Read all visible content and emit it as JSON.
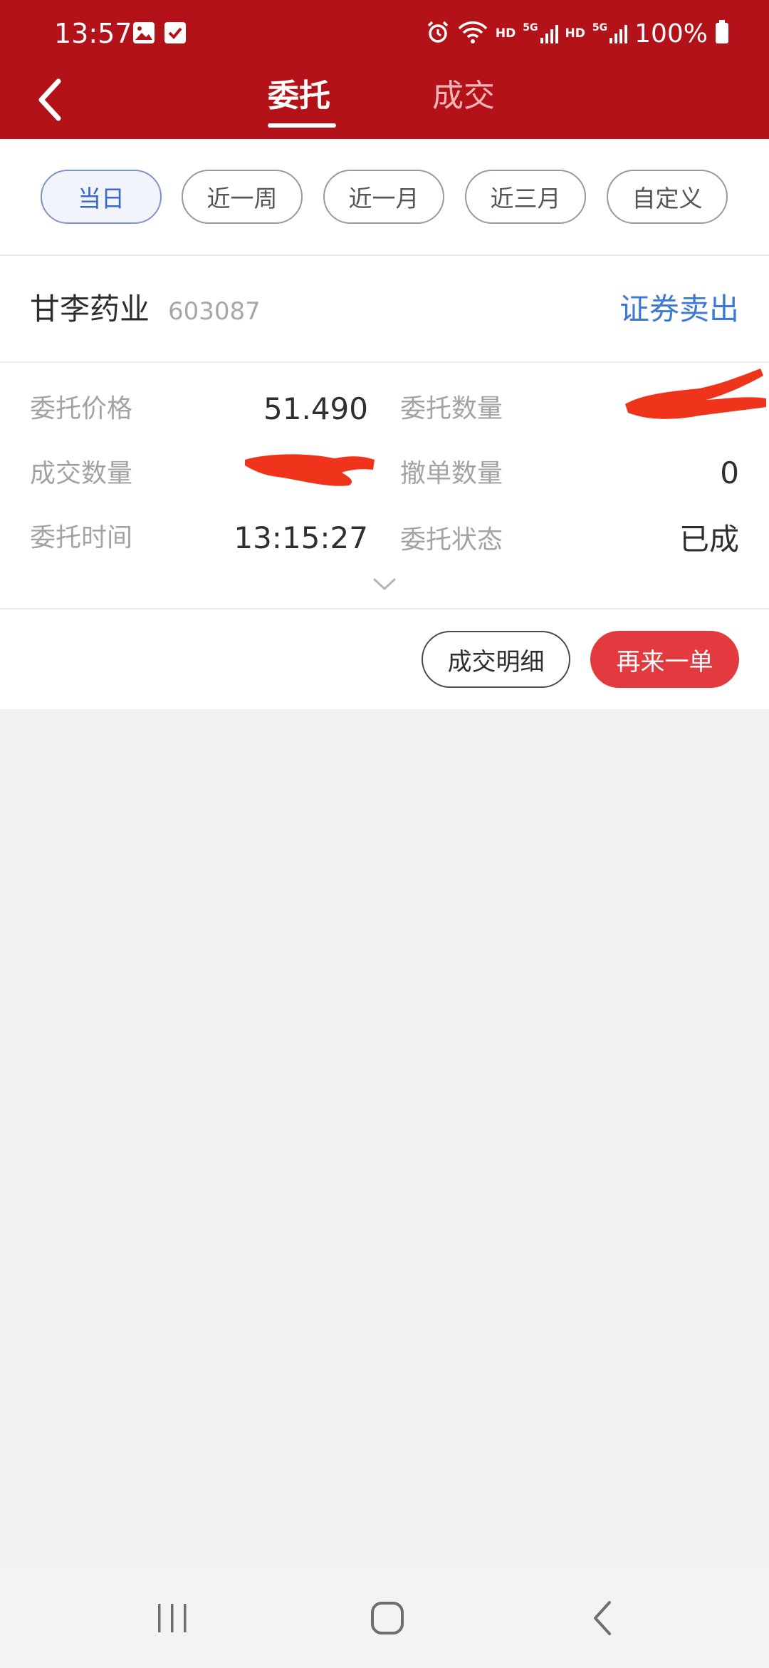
{
  "status_bar": {
    "time": "13:57",
    "hd_1": "HD",
    "signal_1": "5G",
    "hd_2": "HD",
    "signal_2": "5G",
    "battery": "100%"
  },
  "nav": {
    "tabs": [
      {
        "label": "委托",
        "active": true
      },
      {
        "label": "成交",
        "active": false
      }
    ]
  },
  "filters": [
    {
      "label": "当日",
      "active": true
    },
    {
      "label": "近一周",
      "active": false
    },
    {
      "label": "近一月",
      "active": false
    },
    {
      "label": "近三月",
      "active": false
    },
    {
      "label": "自定义",
      "active": false
    }
  ],
  "order": {
    "stock_name": "甘李药业",
    "stock_code": "603087",
    "type": "证券卖出",
    "fields": {
      "price_label": "委托价格",
      "price_value": "51.490",
      "quantity_label": "委托数量",
      "filled_label": "成交数量",
      "cancelled_label": "撤单数量",
      "cancelled_value": "0",
      "time_label": "委托时间",
      "time_value": "13:15:27",
      "status_label": "委托状态",
      "status_value": "已成"
    }
  },
  "actions": {
    "details_label": "成交明细",
    "reorder_label": "再来一单"
  },
  "colors": {
    "header_bg": "#b31218",
    "accent_blue": "#3d7ad8",
    "primary_button": "#e23a3e",
    "redaction": "#f0341b"
  },
  "icons": {
    "back": "chevron-left-icon",
    "expand": "chevron-down-icon",
    "recents": "recent-apps-icon",
    "home": "home-icon",
    "system_back": "system-back-icon"
  }
}
